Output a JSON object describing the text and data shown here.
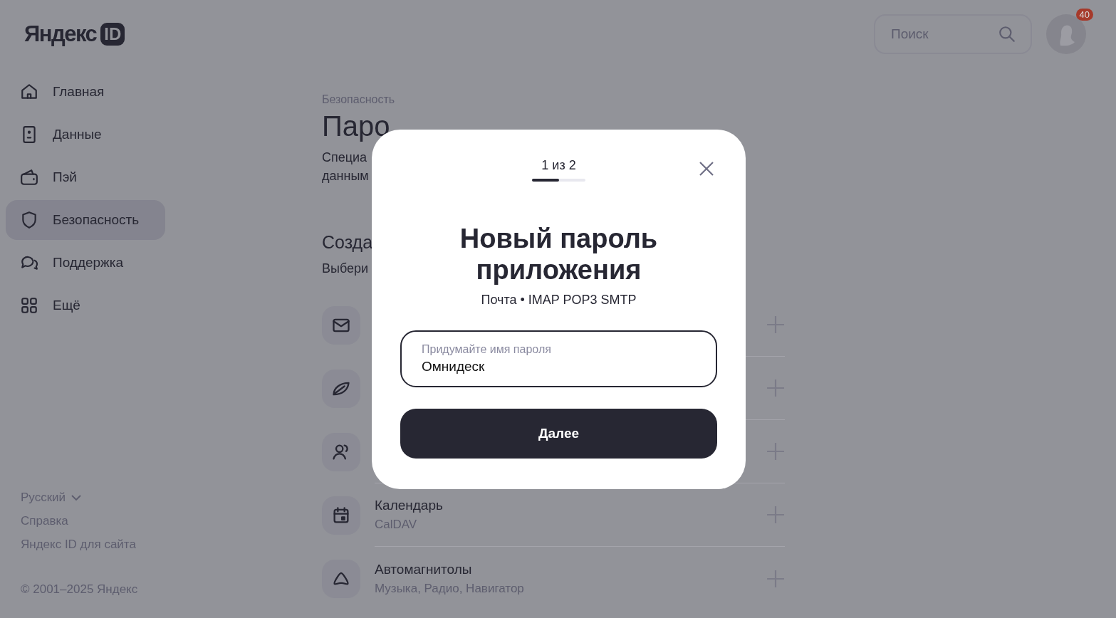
{
  "header": {
    "logo": {
      "word": "Яндекс",
      "badge": "ID"
    },
    "search": {
      "placeholder": "Поиск"
    },
    "notifications": {
      "count": "40"
    }
  },
  "sidebar": {
    "items": [
      {
        "label": "Главная",
        "selected": false
      },
      {
        "label": "Данные",
        "selected": false
      },
      {
        "label": "Пэй",
        "selected": false
      },
      {
        "label": "Безопасность",
        "selected": true
      },
      {
        "label": "Поддержка",
        "selected": false
      },
      {
        "label": "Ещё",
        "selected": false
      }
    ],
    "language": "Русский",
    "links": [
      "Справка",
      "Яндекс ID для сайта"
    ],
    "copyright": "© 2001–2025 Яндекс"
  },
  "main": {
    "breadcrumb": "Безопасность",
    "title": "Паро",
    "description_lines": [
      "Специа",
      "данным"
    ],
    "section_title": "Созда",
    "section_hint": "Выбери",
    "apps": [
      {
        "kind": "hidden"
      },
      {
        "kind": "hidden"
      },
      {
        "kind": "hidden"
      },
      {
        "kind": "listed",
        "name": "Календарь",
        "protocols": "CalDAV"
      },
      {
        "kind": "listed",
        "name": "Автомагнитолы",
        "protocols": "Музыка, Радио, Навигатор"
      }
    ]
  },
  "dialog": {
    "step": "1 из 2",
    "progress": {
      "level": 0.5
    },
    "title": "Новый пароль приложения",
    "subtitle": "Почта • IMAP POP3 SMTP",
    "field": {
      "placeholder": "Придумайте имя пароля",
      "value": "Омнидеск"
    },
    "button": "Далее"
  }
}
